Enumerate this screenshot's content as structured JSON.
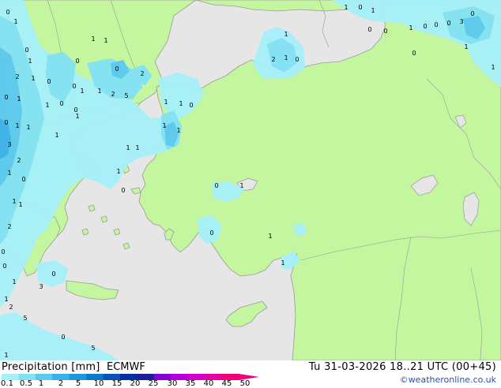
{
  "legend": {
    "title": "Precipitation [mm]",
    "model": "ECMWF",
    "ticks": [
      "0.1",
      "0.5",
      "1",
      "2",
      "5",
      "10",
      "15",
      "20",
      "25",
      "30",
      "35",
      "40",
      "45",
      "50"
    ],
    "colors": [
      "#a6f0fa",
      "#82e1f5",
      "#5ac8f0",
      "#3ab0ea",
      "#1f96dc",
      "#0f78c8",
      "#0a55b4",
      "#0032a0",
      "#1e1e96",
      "#8a00d2",
      "#b400dc",
      "#d200c8",
      "#e600a0",
      "#f00078"
    ]
  },
  "valid": "Tu 31-03-2026 18..21 UTC (00+45)",
  "credit": "©weatheronline.co.uk",
  "colors": {
    "land": "#c4f59f",
    "sea": "#e6e6e6",
    "outside": "#e6e6e6",
    "coast": "#9a9a9a"
  },
  "map_labels": [
    "0",
    "1",
    "0",
    "1",
    "2",
    "0",
    "0",
    "1",
    "1",
    "0",
    "1",
    "1",
    "2",
    "5",
    "2",
    "1",
    "1",
    "0",
    "0",
    "1",
    "1",
    "1",
    "0",
    "0",
    "1",
    "1",
    "0",
    "1",
    "1",
    "0",
    "3",
    "2",
    "0",
    "1",
    "1",
    "2",
    "1",
    "0",
    "1",
    "1",
    "1",
    "1",
    "2",
    "1",
    "0",
    "1",
    "1",
    "0",
    "1",
    "0",
    "0",
    "1",
    "0",
    "0",
    "0",
    "3",
    "0",
    "1",
    "1",
    "0",
    "0",
    "1",
    "1",
    "0",
    "1",
    "3",
    "0",
    "1",
    "2",
    "5",
    "1",
    "0",
    "5",
    "1",
    "0",
    "0",
    "1",
    "0"
  ]
}
